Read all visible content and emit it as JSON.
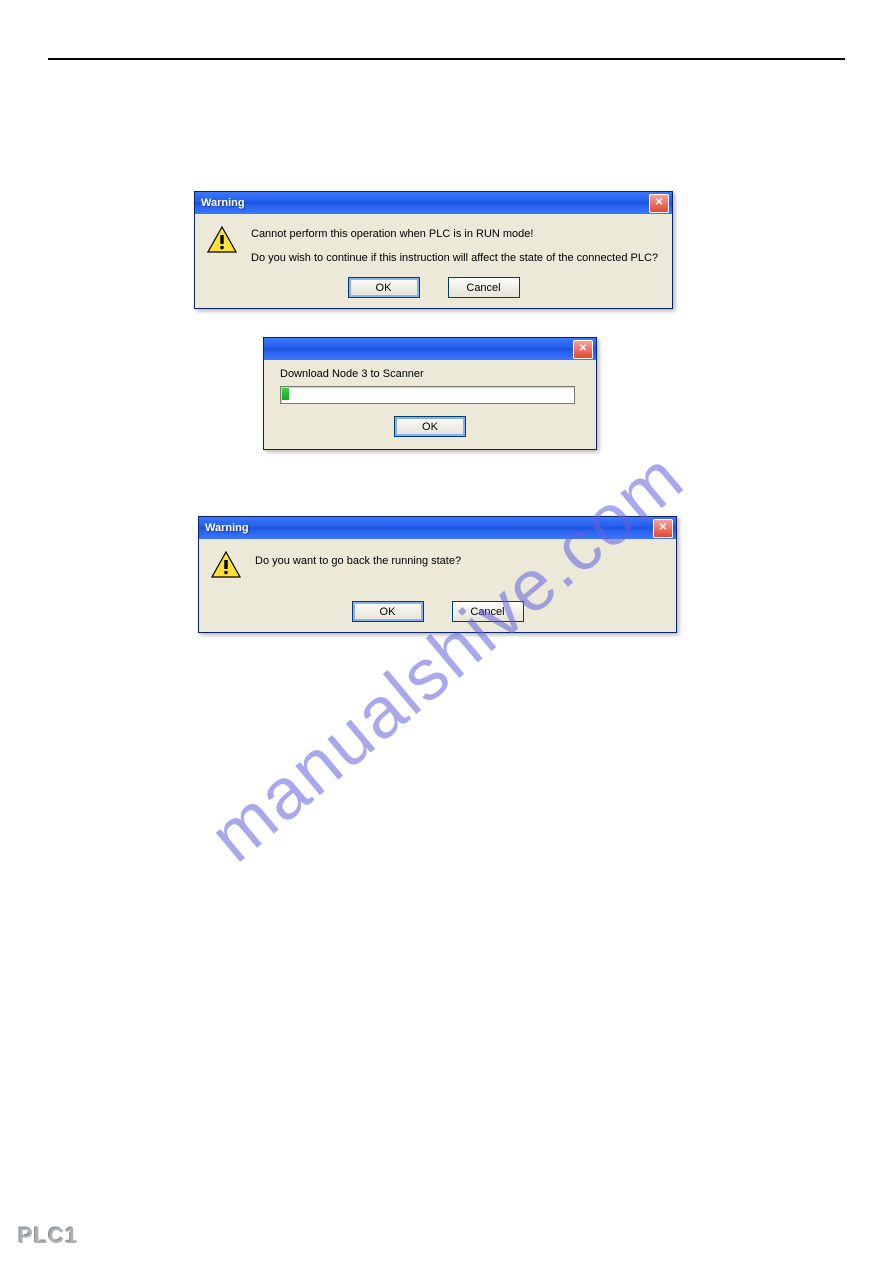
{
  "dialog1": {
    "title": "Warning",
    "line1": "Cannot perform this operation when PLC is in RUN mode!",
    "line2": "Do you wish to continue if this instruction will affect the state of the connected PLC?",
    "ok": "OK",
    "cancel": "Cancel"
  },
  "dialog2": {
    "label": "Download Node 3 to Scanner",
    "ok": "OK"
  },
  "dialog3": {
    "title": "Warning",
    "line1": "Do you want to go back the running state?",
    "ok": "OK",
    "cancel": "Cancel"
  },
  "watermark": "manualshive.com",
  "badge": "PLC1"
}
